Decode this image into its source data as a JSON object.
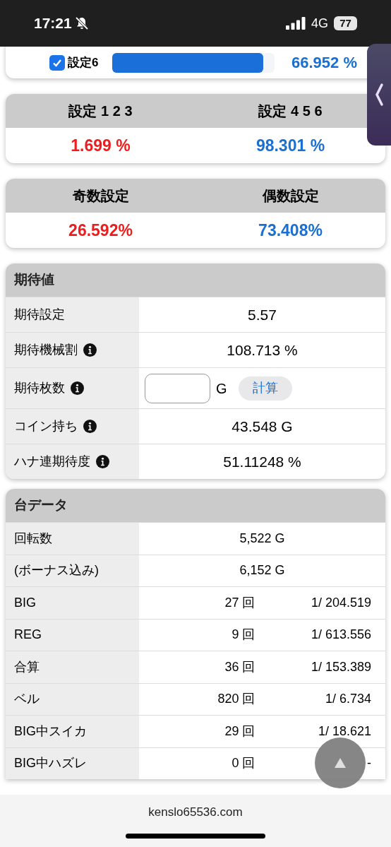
{
  "status_bar": {
    "time": "17:21",
    "network": "4G",
    "battery": "77"
  },
  "setting_row": {
    "label": "設定6",
    "checked": true,
    "level": 0.93,
    "value": "66.952 %"
  },
  "split_cards": [
    {
      "left": {
        "label": "設定 1 2 3",
        "value": "1.699 %",
        "color": "#ee1c1c"
      },
      "right": {
        "label": "設定 4 5 6",
        "value": "98.301 %",
        "color": "#1a6fd0"
      }
    },
    {
      "left": {
        "label": "奇数設定",
        "value": "26.592%",
        "color": "#ee1c1c"
      },
      "right": {
        "label": "偶数設定",
        "value": "73.408%",
        "color": "#1a6fd0"
      }
    }
  ],
  "expected": {
    "title": "期待値",
    "rows": [
      {
        "kind": "value",
        "label": "期待設定",
        "info": false,
        "value": "5.57"
      },
      {
        "kind": "value",
        "label": "期待機械割",
        "info": true,
        "value": "108.713 %"
      },
      {
        "kind": "input",
        "label": "期待枚数",
        "info": true,
        "unit": "G",
        "button": "計算"
      },
      {
        "kind": "value",
        "label": "コイン持ち",
        "info": true,
        "value": "43.548 G"
      },
      {
        "kind": "value",
        "label": "ハナ連期待度",
        "info": true,
        "value": "51.11248 %"
      }
    ]
  },
  "machine_data": {
    "title": "台データ",
    "rows": [
      {
        "kind": "value",
        "label": "回転数",
        "value": "5,522 G"
      },
      {
        "kind": "value",
        "label": "(ボーナス込み)",
        "value": "6,152 G"
      },
      {
        "kind": "split",
        "label": "BIG",
        "count": "27 回",
        "rate": "1/ 204.519"
      },
      {
        "kind": "split",
        "label": "REG",
        "count": "9 回",
        "rate": "1/ 613.556"
      },
      {
        "kind": "split",
        "label": "合算",
        "count": "36 回",
        "rate": "1/ 153.389"
      },
      {
        "kind": "split",
        "label": "ベル",
        "count": "820 回",
        "rate": "1/ 6.734"
      },
      {
        "kind": "split",
        "label": "BIG中スイカ",
        "count": "29 回",
        "rate": "1/ 18.621"
      },
      {
        "kind": "split",
        "label": "BIG中ハズレ",
        "count": "0 回",
        "rate": "-"
      }
    ]
  },
  "address_bar": {
    "url": "kenslo65536.com"
  }
}
